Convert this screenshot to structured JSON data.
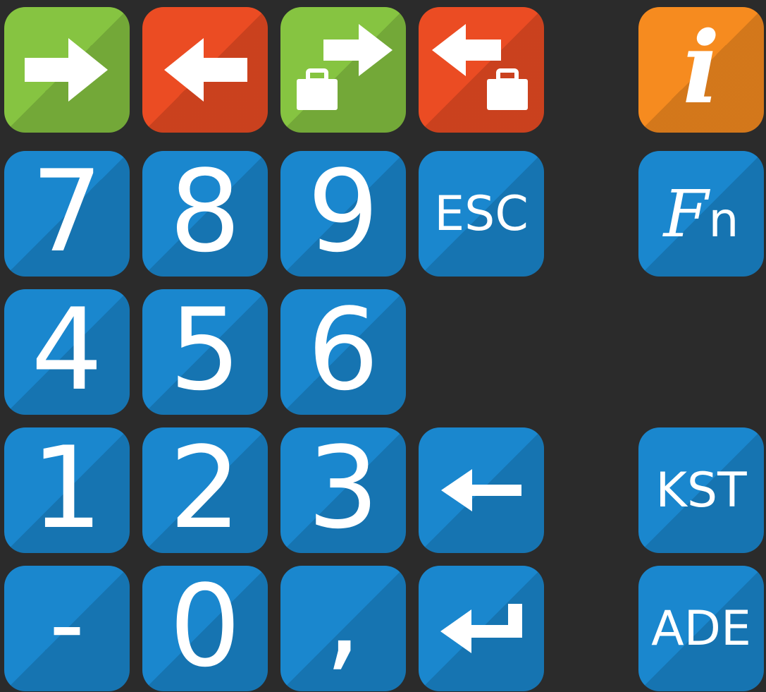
{
  "colors": {
    "background": "#2b2b2b",
    "blue": "#1a87ce",
    "green": "#86c441",
    "red": "#eb4c23",
    "orange": "#f68b1f",
    "glyph": "#ffffff"
  },
  "toprow": {
    "forward_icon": "arrow-right-icon",
    "back_icon": "arrow-left-icon",
    "forward_case_icon": "arrow-right-briefcase-icon",
    "back_case_icon": "arrow-left-briefcase-icon",
    "info_label": "i"
  },
  "keypad": {
    "seven": "7",
    "eight": "8",
    "nine": "9",
    "esc": "ESC",
    "fn_f": "F",
    "fn_n": "n",
    "four": "4",
    "five": "5",
    "six": "6",
    "one": "1",
    "two": "2",
    "three": "3",
    "backspace_icon": "arrow-left-icon",
    "kst": "KST",
    "minus": "-",
    "zero": "0",
    "comma": ",",
    "enter_icon": "enter-return-icon",
    "ade": "ADE"
  }
}
